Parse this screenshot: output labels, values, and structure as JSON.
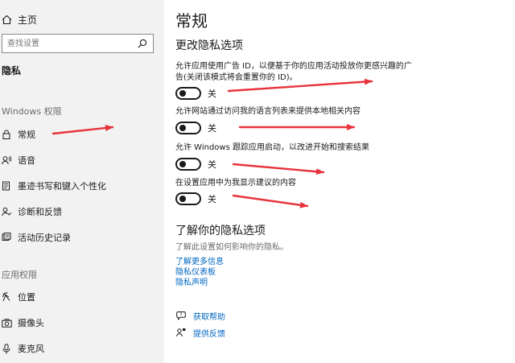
{
  "sidebar": {
    "home_label": "主页",
    "search_placeholder": "查找设置",
    "section_title": "隐私",
    "windows_group_label": "Windows 权限",
    "windows_items": [
      {
        "label": "常规",
        "icon": "lock-icon"
      },
      {
        "label": "语音",
        "icon": "speech-icon"
      },
      {
        "label": "墨迹书写和键入个性化",
        "icon": "inking-icon"
      },
      {
        "label": "诊断和反馈",
        "icon": "diagnostics-icon"
      },
      {
        "label": "活动历史记录",
        "icon": "activity-history-icon"
      }
    ],
    "app_group_label": "应用权限",
    "app_items": [
      {
        "label": "位置",
        "icon": "location-icon"
      },
      {
        "label": "摄像头",
        "icon": "camera-icon"
      },
      {
        "label": "麦克风",
        "icon": "microphone-icon"
      }
    ]
  },
  "main": {
    "page_title": "常规",
    "options_title": "更改隐私选项",
    "options": [
      {
        "description": "允许应用使用广告 ID，以便基于你的应用活动投放你更感兴趣的广告(关闭该模式将会重置你的 ID)。",
        "state": "关"
      },
      {
        "description": "允许网站通过访问我的语言列表来提供本地相关内容",
        "state": "关"
      },
      {
        "description": "允许 Windows 跟踪应用启动，以改进开始和搜索结果",
        "state": "关"
      },
      {
        "description": "在设置应用中为我显示建议的内容",
        "state": "关"
      }
    ],
    "know_title": "了解你的隐私选项",
    "know_desc": "了解此设置如何影响你的隐私。",
    "links": [
      "了解更多信息",
      "隐私仪表板",
      "隐私声明"
    ],
    "help_links": [
      {
        "label": "获取帮助",
        "icon": "help-chat-icon"
      },
      {
        "label": "提供反馈",
        "icon": "feedback-icon"
      }
    ]
  },
  "colors": {
    "sidebar_bg": "#f2f2f2",
    "link": "#0067c0",
    "annotation_arrow": "#e8323c"
  }
}
